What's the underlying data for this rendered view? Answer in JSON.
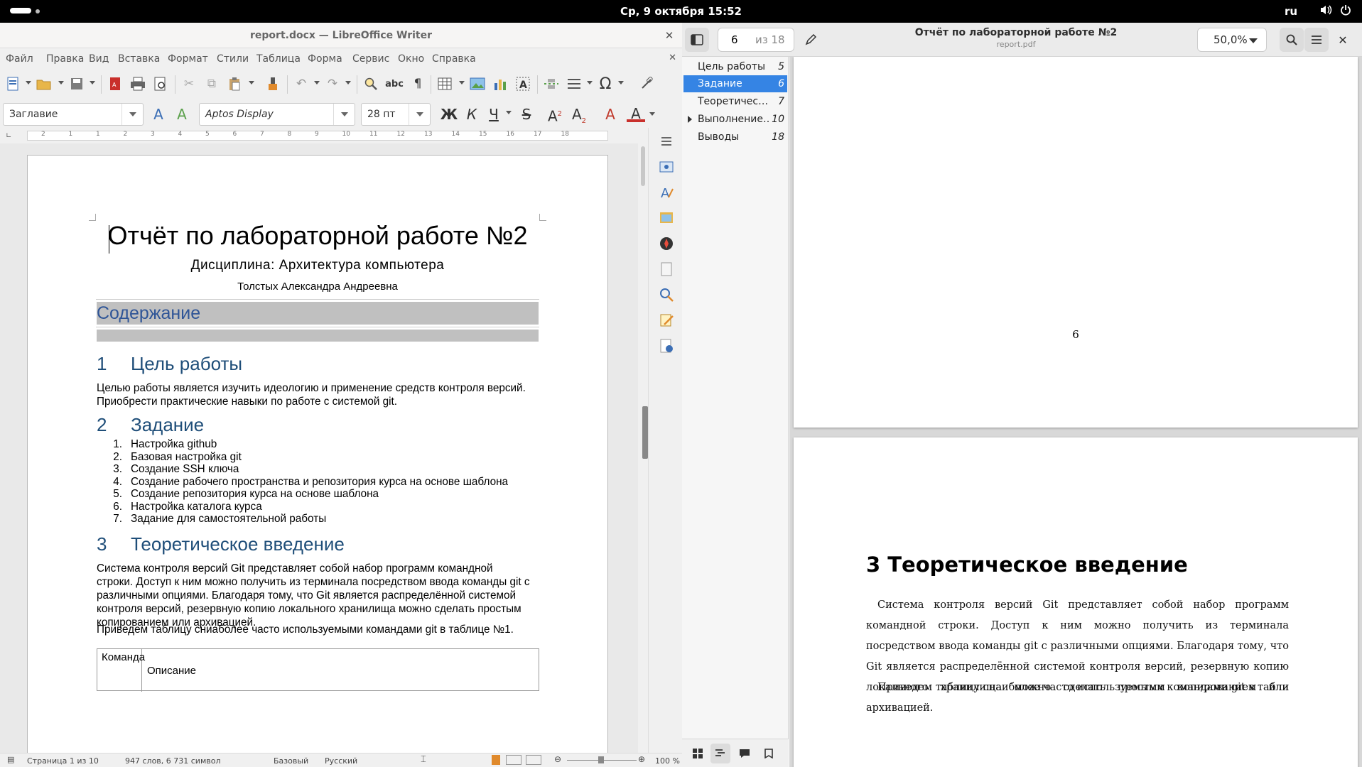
{
  "topbar": {
    "datetime": "Ср, 9 октября  15:52",
    "lang": "ru"
  },
  "writer": {
    "title": "report.docx — LibreOffice Writer",
    "menu": [
      "Файл",
      "Правка",
      "Вид",
      "Вставка",
      "Формат",
      "Стили",
      "Таблица",
      "Форма",
      "Сервис",
      "Окно",
      "Справка"
    ],
    "paragraph_style": "Заглавие",
    "font_name": "Aptos Display",
    "font_size": "28 пт",
    "ruler_numbers": [
      "2",
      "1",
      "1",
      "2",
      "3",
      "4",
      "5",
      "6",
      "7",
      "8",
      "9",
      "10",
      "11",
      "12",
      "13",
      "14",
      "15",
      "16",
      "17",
      "18"
    ],
    "doc": {
      "title": "Отчёт по лабораторной работе №2",
      "subtitle": "Дисциплина: Архитектура компьютера",
      "author": "Толстых Александра Андреевна",
      "toc_heading": "Содержание",
      "sections": [
        {
          "num": "1",
          "title": "Цель работы"
        },
        {
          "num": "2",
          "title": "Задание"
        },
        {
          "num": "3",
          "title": "Теоретическое введение"
        }
      ],
      "goal_text": "Целью работы является изучить идеологию и применение средств контроля версий. Приобрести практические навыки по работе с системой git.",
      "tasks": [
        "Настройка github",
        "Базовая настройка git",
        "Создание SSH ключа",
        "Создание рабочего пространства и репозитория курса на основе шаблона",
        "Создание репозитория курса на основе шаблона",
        "Настройка каталога курса",
        "Задание для самостоятельной работы"
      ],
      "theory_text": "Система контроля версий Git представляет собой набор программ командной строки. Доступ к ним можно получить из терминала посредством ввода команды git с различными опциями. Благодаря тому, что Git является распределённой системой контроля версий, резервную копию локального хранилища можно сделать простым копированием или архивацией.",
      "table_intro": "Приведем таблицу сниаболее часто используемыми командами git в таблице №1.",
      "table_col1": "Команда",
      "table_col2": "Описание"
    },
    "status": {
      "page": "Страница 1 из 10",
      "words": "947 слов, 6 731 символ",
      "style": "Базовый",
      "language": "Русский",
      "zoom": "100 %"
    }
  },
  "pdf": {
    "page_current": "6",
    "page_total": "из 18",
    "title": "Отчёт по лабораторной работе №2",
    "filename": "report.pdf",
    "zoom": "50,0%",
    "outline": [
      {
        "label": "Цель работы",
        "page": "5",
        "selected": false,
        "expandable": false
      },
      {
        "label": "Задание",
        "page": "6",
        "selected": true,
        "expandable": false
      },
      {
        "label": "Теоретичес…",
        "page": "7",
        "selected": false,
        "expandable": false
      },
      {
        "label": "Выполнение…",
        "page": "10",
        "selected": false,
        "expandable": true
      },
      {
        "label": "Выводы",
        "page": "18",
        "selected": false,
        "expandable": false
      }
    ],
    "page6_number": "6",
    "page7_heading": "3  Теоретическое введение",
    "page7_para1": "Система контроля версий Git представляет собой набор программ командной строки. Доступ к ним можно получить из терминала посредством ввода команды git с различными опциями. Благодаря тому, что Git является распределённой системой контроля версий, резервную копию локального хранилища можно сделать простым копированием или архивацией.",
    "page7_para2": "Приведем таблицу снаиболее часто используемыми командами git в таблице"
  },
  "colors": {
    "accent": "#3584e4",
    "heading": "#1f4e79",
    "toc_heading": "#2f5597"
  }
}
